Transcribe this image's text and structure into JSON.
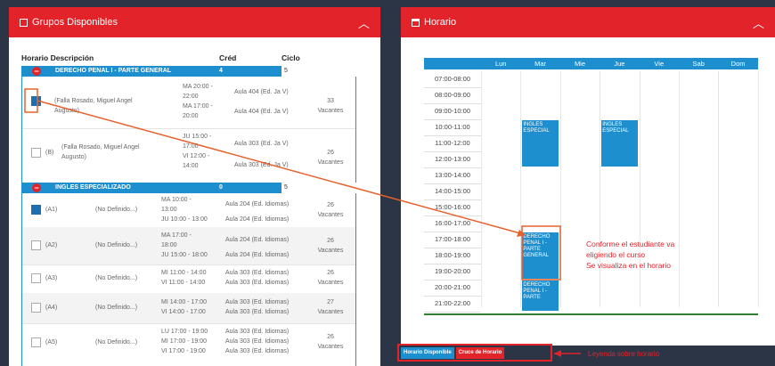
{
  "left_panel": {
    "title": "Grupos Disponibles",
    "columns": [
      "Horario Descripción",
      "Créd",
      "Ciclo"
    ],
    "courses": [
      {
        "name": "DERECHO PENAL I - PARTE GENERAL",
        "credits": "4",
        "cycle": "5",
        "groups": [
          {
            "check": "on",
            "code": "",
            "teacher1": "(Falla Rosado, Miguel Angel",
            "teacher2": "Augusto)",
            "time1": "MA 20:00 -",
            "time2": "22:00",
            "time3": "MA 17:00 -",
            "time4": "20:00",
            "room1": "Aula 404 (Ed. Ja V)",
            "room2": "Aula 404 (Ed. Ja V)",
            "vac_n": "33",
            "vac_l": "Vacantes"
          },
          {
            "check": "off",
            "code": "(B)",
            "teacher1": "(Falla Rosado, Miguel Angel",
            "teacher2": "Augusto)",
            "time1": "JU 15:00 -",
            "time2": "17:00",
            "time3": "VI 12:00 -",
            "time4": "14:00",
            "room1": "Aula 303 (Ed. Ja V)",
            "room2": "Aula 303 (Ed. Ja V)",
            "vac_n": "26",
            "vac_l": "Vacantes"
          }
        ]
      },
      {
        "name": "INGLES ESPECIALIZADO",
        "credits": "0",
        "cycle": "5",
        "groups": [
          {
            "check": "on",
            "code": "(A1)",
            "teacher": "(No Definido...)",
            "time1": "MA 10:00 -",
            "time2": "13:00",
            "time3": "JU 10:00 - 13:00",
            "room1": "Aula 204 (Ed. Idiomas)",
            "room2": "Aula 204 (Ed. Idiomas)",
            "vac_n": "26",
            "vac_l": "Vacantes"
          },
          {
            "check": "off",
            "code": "(A2)",
            "teacher": "(No Definido...)",
            "time1": "MA 17:00 -",
            "time2": "18:00",
            "time3": "JU 15:00 - 18:00",
            "room1": "Aula 204 (Ed. Idiomas)",
            "room2": "Aula 204 (Ed. Idiomas)",
            "vac_n": "26",
            "vac_l": "Vacantes"
          },
          {
            "check": "off",
            "code": "(A3)",
            "teacher": "(No Definido...)",
            "time1": "MI 11:00 - 14:00",
            "time2": "VI 11:00 - 14:00",
            "room1": "Aula 303 (Ed. Idiomas)",
            "room2": "Aula 303 (Ed. Idiomas)",
            "vac_n": "26",
            "vac_l": "Vacantes"
          },
          {
            "check": "off",
            "code": "(A4)",
            "teacher": "(No Definido...)",
            "time1": "MI 14:00 - 17:00",
            "time2": "VI 14:00 - 17:00",
            "room1": "Aula 303 (Ed. Idiomas)",
            "room2": "Aula 303 (Ed. Idiomas)",
            "vac_n": "27",
            "vac_l": "Vacantes"
          },
          {
            "check": "off",
            "code": "(A5)",
            "teacher": "(No Definido...)",
            "time1": "LU 17:00 - 19:00",
            "time2": "MI 17:00 - 19:00",
            "time3": "VI 17:00 - 19:00",
            "room1": "Aula 303 (Ed. Idiomas)",
            "room2": "Aula 303 (Ed. Idiomas)",
            "room3": "Aula 303 (Ed. Idiomas)",
            "vac_n": "26",
            "vac_l": "Vacantes"
          }
        ]
      }
    ]
  },
  "right_panel": {
    "title": "Horario",
    "days": [
      "Lun",
      "Mar",
      "Mie",
      "Jue",
      "Vie",
      "Sab",
      "Dom"
    ],
    "hours": [
      "07:00-08:00",
      "08:00-09:00",
      "09:00-10:00",
      "10:00-11:00",
      "11:00-12:00",
      "12:00-13:00",
      "13:00-14:00",
      "14:00-15:00",
      "15:00-16:00",
      "16:00-17:00",
      "17:00-18:00",
      "18:00-19:00",
      "19:00-20:00",
      "20:00-21:00",
      "21:00-22:00"
    ],
    "blocks": [
      {
        "label": "INGLES ESPECIAL",
        "day": 1,
        "start": 10,
        "end": 13
      },
      {
        "label": "INGLES ESPECIAL",
        "day": 3,
        "start": 10,
        "end": 13
      },
      {
        "label": "DERECHO PENAL I - PARTE GENERAL",
        "day": 1,
        "start": 17,
        "end": 20
      },
      {
        "label": "DERECHO PENAL I - PARTE",
        "day": 1,
        "start": 20,
        "end": 22
      }
    ]
  },
  "annotation": {
    "line1": "Conforme el estudiante va",
    "line2": "eligiendo el curso",
    "line3": "Se visualiza en el horario"
  },
  "legend": {
    "available": "Horario Disponible",
    "chosen": "Cruce de Horario",
    "note": "Leyenda sobre horario"
  },
  "colors": {
    "brand_red": "#e2232a",
    "blue": "#1d8fcf",
    "arrow": "#e8612c"
  },
  "icons": {
    "left_title": "panel-icon",
    "right_title": "calendar-icon",
    "collapse": "chevron-up-icon",
    "course": "minus-circle-icon"
  }
}
